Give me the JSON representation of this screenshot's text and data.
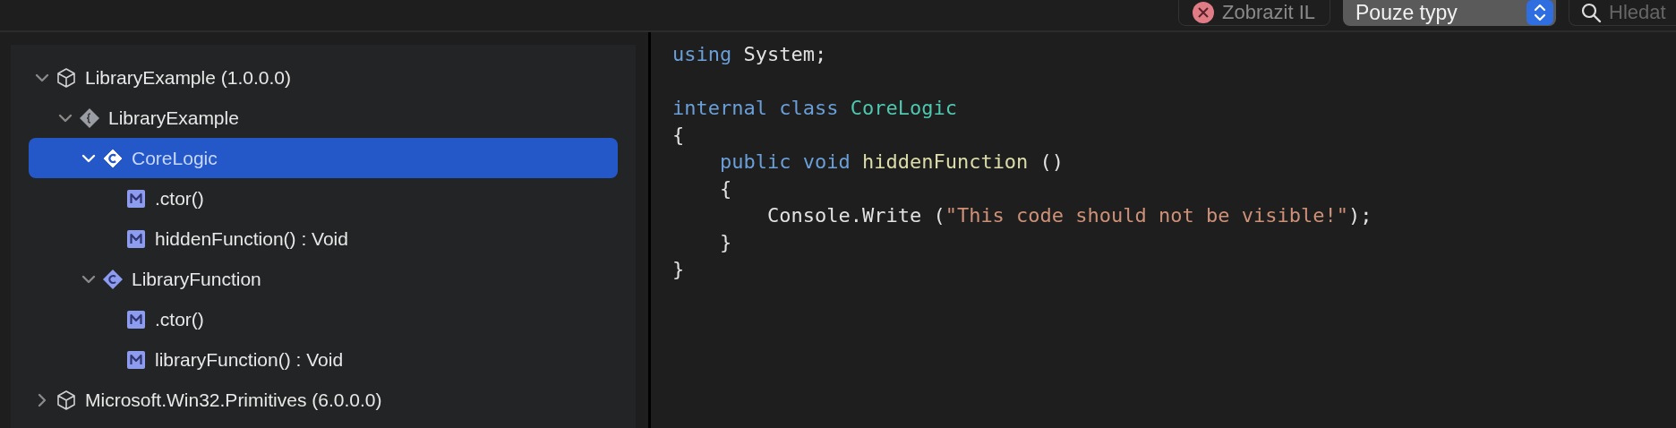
{
  "toolbar": {
    "il_button": {
      "label": "Zobrazit IL"
    },
    "view_select": {
      "value": "Pouze typy"
    },
    "search": {
      "placeholder": "Hledat"
    }
  },
  "tree": [
    {
      "label": "LibraryExample (1.0.0.0)",
      "kind": "assembly",
      "expanded": true,
      "selected": false,
      "children": [
        {
          "label": "LibraryExample",
          "kind": "namespace",
          "expanded": true,
          "selected": false,
          "children": [
            {
              "label": "CoreLogic",
              "kind": "class",
              "expanded": true,
              "selected": true,
              "children": [
                {
                  "label": ".ctor()",
                  "kind": "method",
                  "selected": false
                },
                {
                  "label": "hiddenFunction() : Void",
                  "kind": "method",
                  "selected": false
                }
              ]
            },
            {
              "label": "LibraryFunction",
              "kind": "class",
              "expanded": true,
              "selected": false,
              "children": [
                {
                  "label": ".ctor()",
                  "kind": "method",
                  "selected": false
                },
                {
                  "label": "libraryFunction() : Void",
                  "kind": "method",
                  "selected": false
                }
              ]
            }
          ]
        }
      ]
    },
    {
      "label": "Microsoft.Win32.Primitives (6.0.0.0)",
      "kind": "assembly",
      "expanded": false,
      "selected": false
    }
  ],
  "code": {
    "blocks": [
      [
        [
          {
            "text": "using",
            "kind": "keyword"
          },
          {
            "text": " System;",
            "kind": "plain"
          }
        ]
      ],
      [
        [
          {
            "text": "internal class",
            "kind": "keyword"
          },
          {
            "text": " CoreLogic",
            "kind": "type"
          }
        ],
        [
          {
            "text": "{",
            "kind": "plain"
          }
        ],
        [
          {
            "text": "    public void",
            "kind": "keyword"
          },
          {
            "text": " hiddenFunction",
            "kind": "function"
          },
          {
            "text": " ()",
            "kind": "plain"
          }
        ],
        [
          {
            "text": "    {",
            "kind": "plain"
          }
        ],
        [
          {
            "text": "        Console.Write (",
            "kind": "plain"
          },
          {
            "text": "\"This code should not be visible!\"",
            "kind": "string"
          },
          {
            "text": ");",
            "kind": "plain"
          }
        ],
        [
          {
            "text": "    }",
            "kind": "plain"
          }
        ],
        [
          {
            "text": "}",
            "kind": "plain"
          }
        ]
      ]
    ]
  }
}
